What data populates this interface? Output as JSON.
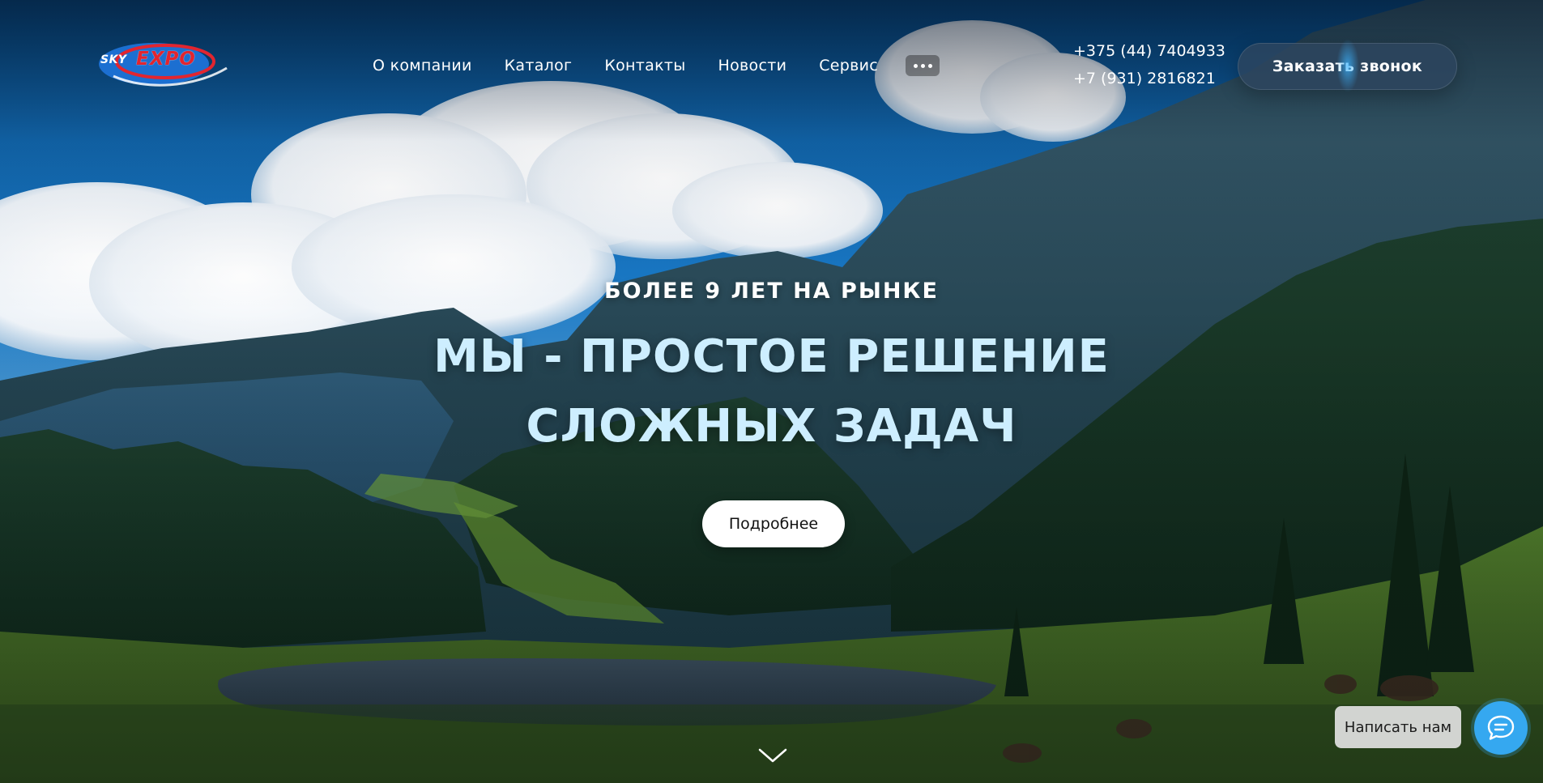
{
  "brand": {
    "logo_word1": "SKY",
    "logo_word2": "EXPO"
  },
  "nav": {
    "items": [
      {
        "label": "О компании"
      },
      {
        "label": "Каталог"
      },
      {
        "label": "Контакты"
      },
      {
        "label": "Новости"
      },
      {
        "label": "Сервис"
      }
    ],
    "more_icon": "ellipsis-icon"
  },
  "contacts": {
    "phone1": "+375 (44) 7404933",
    "phone2": "+7 (931) 2816821",
    "callback_label": "Заказать звонок"
  },
  "hero": {
    "eyebrow": "БОЛЕЕ 9 ЛЕТ НА РЫНКЕ",
    "title_line1": "МЫ - ПРОСТОЕ РЕШЕНИЕ",
    "title_line2": "СЛОЖНЫХ ЗАДАЧ",
    "cta_label": "Подробнее",
    "scroll_icon": "chevron-down-icon"
  },
  "chat": {
    "label": "Написать нам",
    "icon": "chat-bubble-icon",
    "accent": "#35a8f0"
  },
  "colors": {
    "headline": "#cdeeff",
    "logo_red": "#e2252f",
    "logo_blue": "#1c6fd1"
  }
}
